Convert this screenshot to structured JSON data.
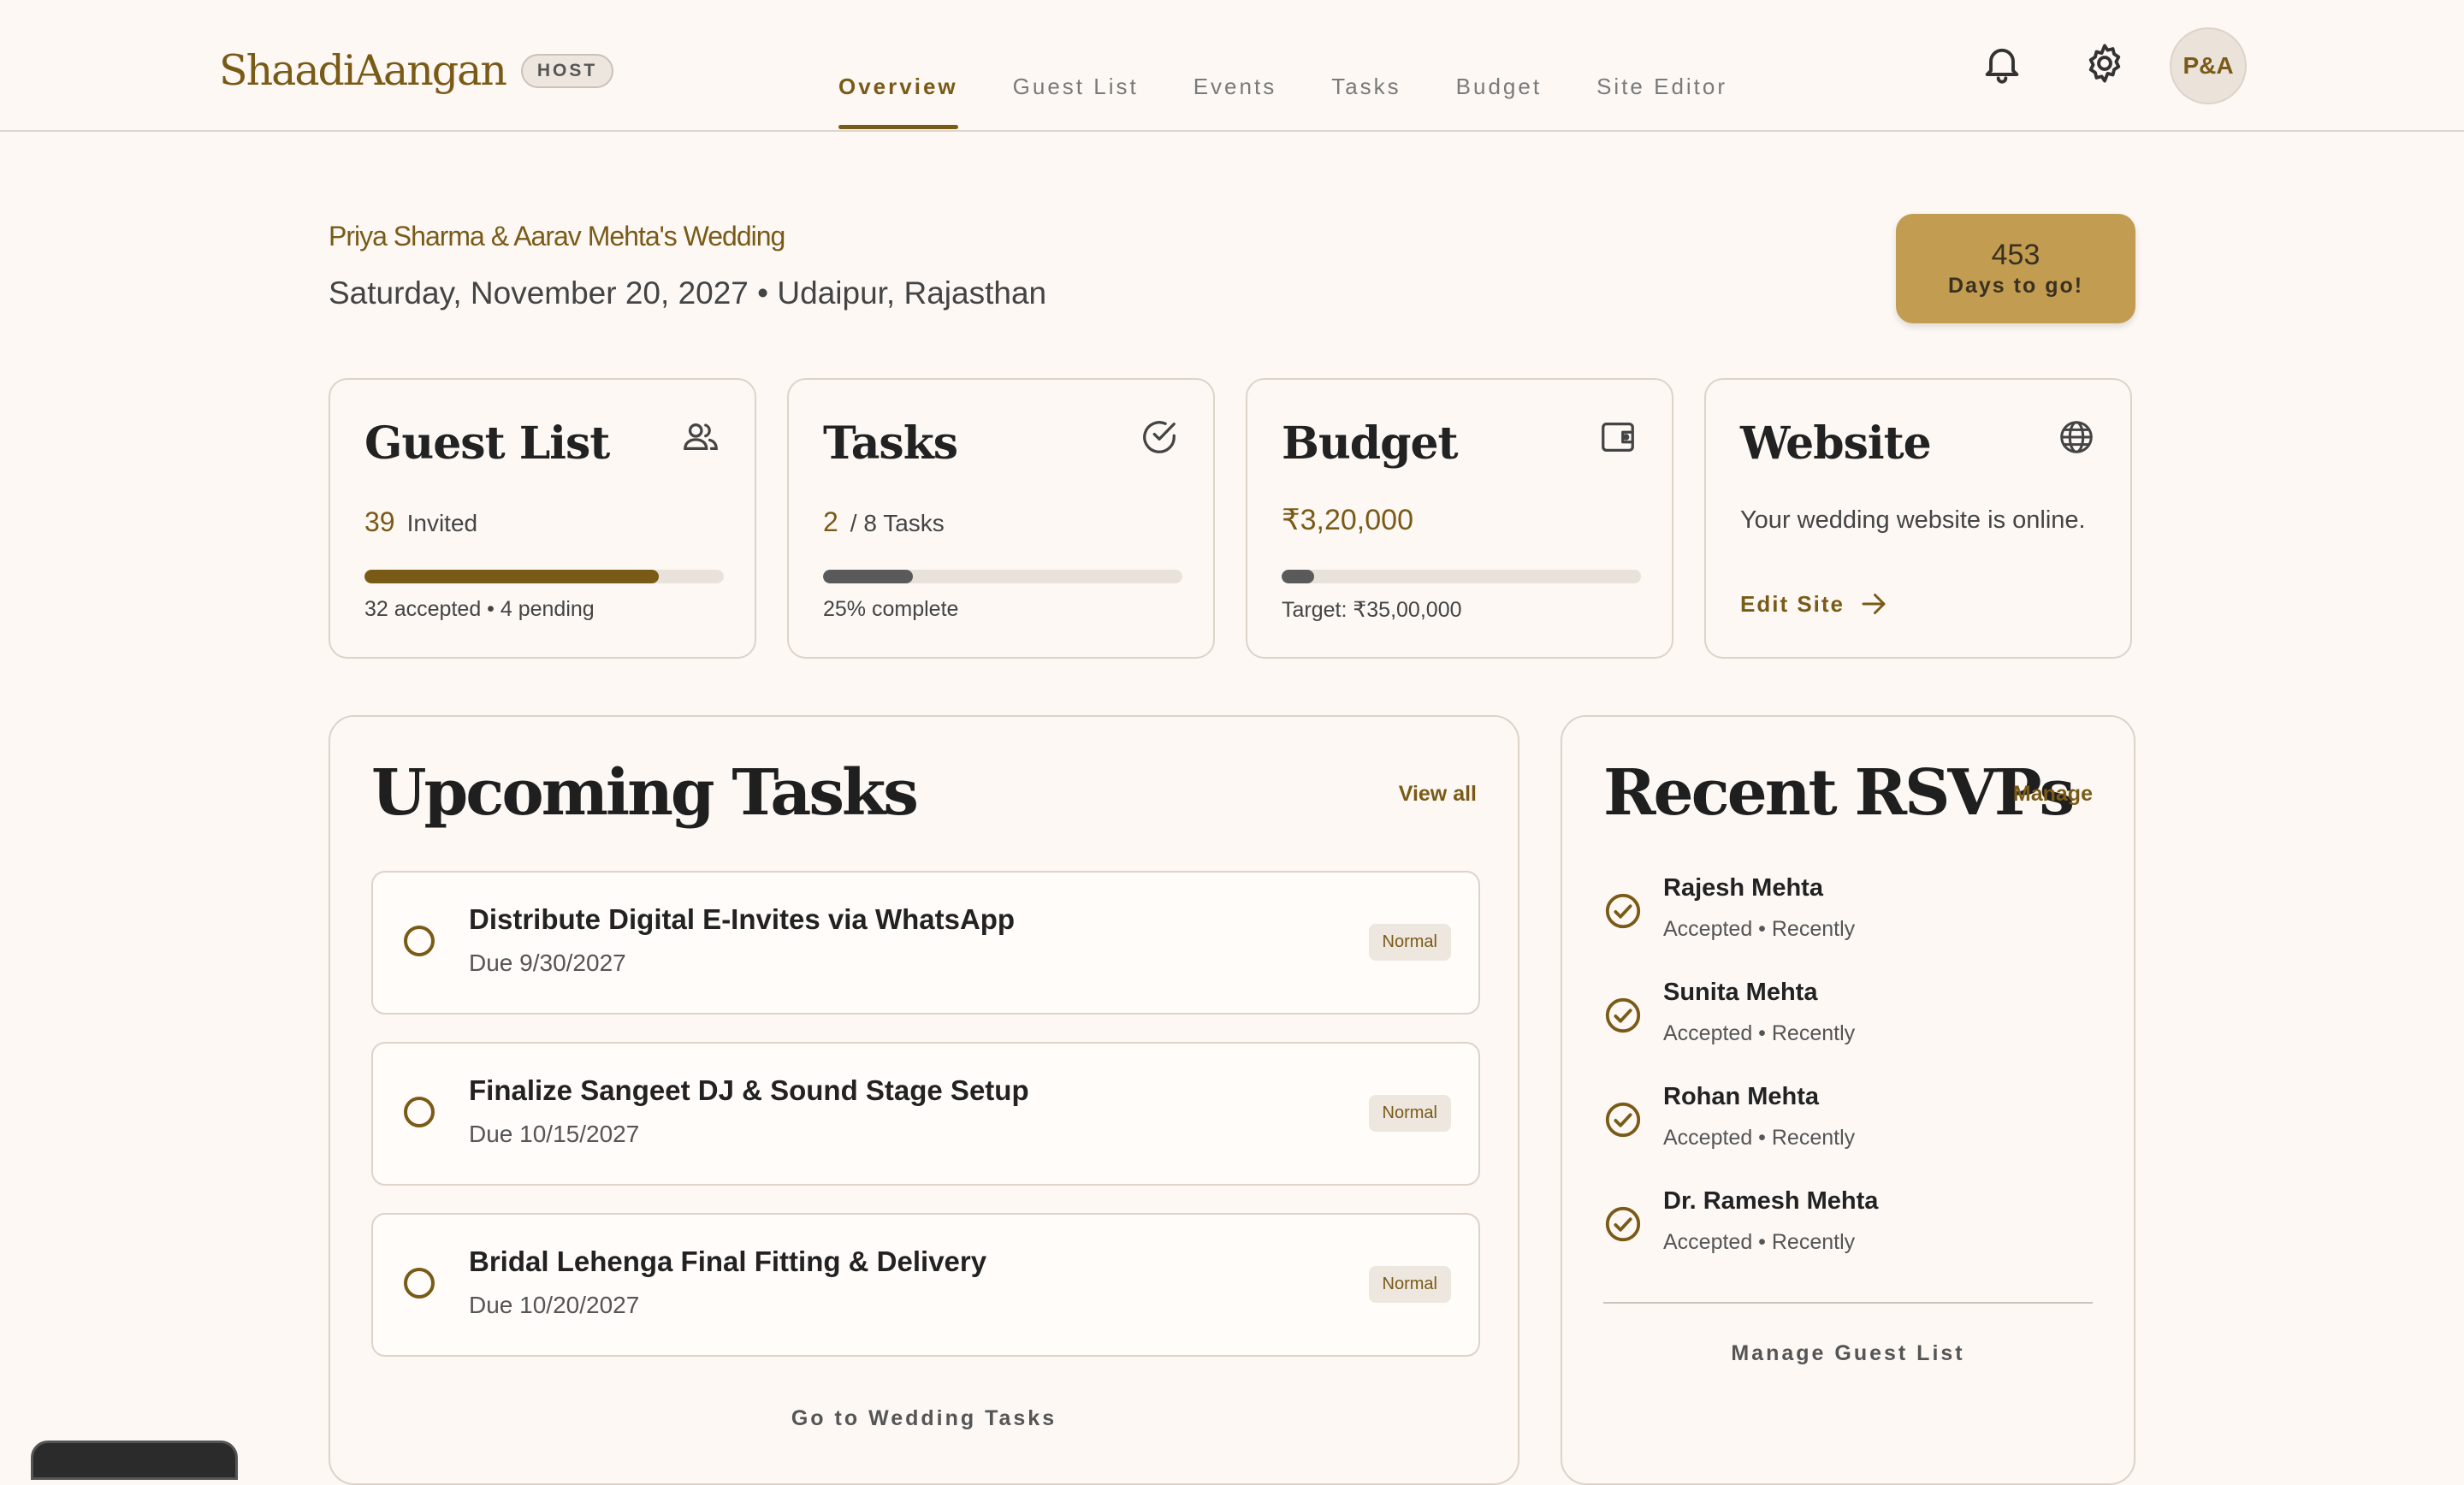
{
  "header": {
    "logo": "ShaadiAangan",
    "badge": "HOST",
    "nav": [
      "Overview",
      "Guest List",
      "Events",
      "Tasks",
      "Budget",
      "Site Editor"
    ],
    "active_nav": "Overview",
    "icons": [
      "bell-icon",
      "gear-icon"
    ],
    "avatar": "P&A"
  },
  "wedding": {
    "couple": "Priya Sharma & Aarav Mehta's Wedding",
    "date_location": "Saturday, November 20, 2027 • Udaipur, Rajasthan",
    "countdown_number": "453",
    "countdown_label": "Days to go!"
  },
  "cards": {
    "guests": {
      "title": "Guest List",
      "count": "39",
      "label": "Invited",
      "progress": 0.82,
      "sub": "32 accepted • 4 pending",
      "icon": "users-icon"
    },
    "tasks": {
      "title": "Tasks",
      "count": "2",
      "label": "/ 8 Tasks",
      "progress": 0.25,
      "sub": "25% complete",
      "icon": "check-circle-icon"
    },
    "budget": {
      "title": "Budget",
      "amount": "₹3,20,000",
      "progress": 0.09,
      "sub": "Target: ₹35,00,000",
      "icon": "wallet-icon"
    },
    "website": {
      "title": "Website",
      "text": "Your wedding website is online.",
      "link": "Edit Site",
      "icon": "globe-icon"
    }
  },
  "upcoming": {
    "title": "Upcoming Tasks",
    "view_all": "View all",
    "items": [
      {
        "title": "Distribute Digital E-Invites via WhatsApp",
        "due": "Due 9/30/2027",
        "priority": "Normal"
      },
      {
        "title": "Finalize Sangeet DJ & Sound Stage Setup",
        "due": "Due 10/15/2027",
        "priority": "Normal"
      },
      {
        "title": "Bridal Lehenga Final Fitting & Delivery",
        "due": "Due 10/20/2027",
        "priority": "Normal"
      }
    ],
    "footer_link": "Go to Wedding Tasks"
  },
  "rsvps": {
    "title": "Recent RSVPs",
    "manage": "Manage",
    "items": [
      {
        "name": "Rajesh Mehta",
        "status": "Accepted • Recently"
      },
      {
        "name": "Sunita Mehta",
        "status": "Accepted • Recently"
      },
      {
        "name": "Rohan Mehta",
        "status": "Accepted • Recently"
      },
      {
        "name": "Dr. Ramesh Mehta",
        "status": "Accepted • Recently"
      }
    ],
    "footer_link": "Manage Guest List"
  },
  "colors": {
    "accent": "#7a5a17",
    "gold": "#c29c50",
    "background": "#fdf8f4",
    "bar_gray": "#5a5a5a"
  }
}
